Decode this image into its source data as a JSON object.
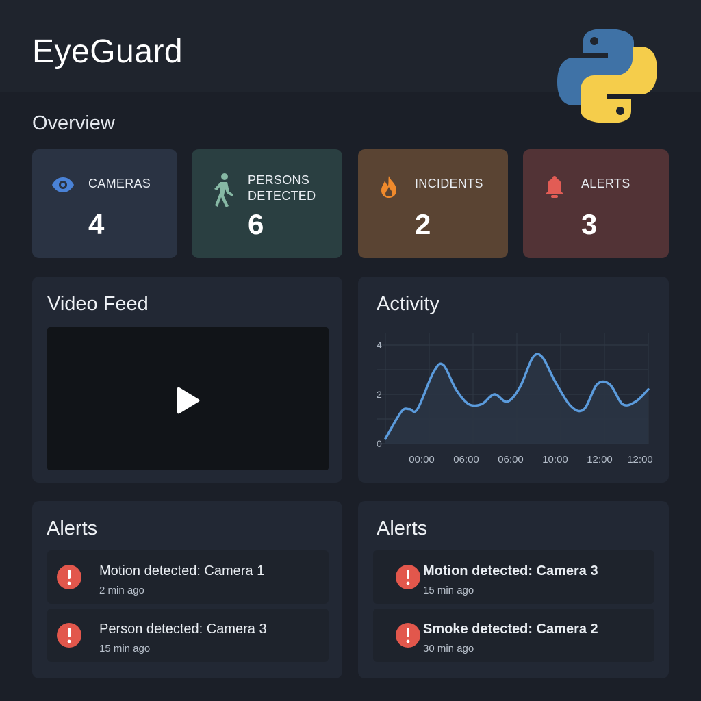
{
  "app": {
    "title": "EyeGuard",
    "logo_icon": "python-logo-icon"
  },
  "overview": {
    "title": "Overview",
    "stats": [
      {
        "label": "CAMERAS",
        "value": "4",
        "icon": "eye-icon",
        "color": "#2a3343",
        "icon_color": "#4a82d6"
      },
      {
        "label": "PERSONS DETECTED",
        "value": "6",
        "icon": "walking-person-icon",
        "color": "#2a3f41",
        "icon_color": "#86b8a4"
      },
      {
        "label": "INCIDENTS",
        "value": "2",
        "icon": "fire-icon",
        "color": "#5a4433",
        "icon_color": "#f08a2c"
      },
      {
        "label": "ALERTS",
        "value": "3",
        "icon": "bell-icon",
        "color": "#523336",
        "icon_color": "#e25c55"
      }
    ]
  },
  "video": {
    "title": "Video Feed",
    "play_icon": "play-icon"
  },
  "activity": {
    "title": "Activity"
  },
  "chart_data": {
    "type": "area",
    "title": "Activity",
    "y_ticks": [
      "0",
      "2",
      "4"
    ],
    "x_ticks": [
      "00:00",
      "06:00",
      "06:00",
      "10:00",
      "12:00",
      "12:00"
    ],
    "ylim": [
      0,
      4.5
    ],
    "grid": true,
    "line_color": "#5b9bdc",
    "series": [
      {
        "values": [
          0.2,
          1.3,
          1.4,
          1.4,
          2.9,
          3.2,
          2.2,
          1.6,
          1.6,
          2.0,
          1.7,
          2.3,
          3.5,
          3.5,
          2.5,
          1.5,
          1.4,
          2.4,
          2.4,
          1.6,
          1.7,
          2.2
        ]
      }
    ],
    "x": [
      0,
      1,
      1.5,
      2,
      3,
      3.6,
      4.4,
      5.2,
      6,
      6.8,
      7.6,
      8.4,
      9.2,
      9.8,
      10.6,
      11.6,
      12.4,
      13.2,
      14,
      14.8,
      15.6,
      16.4
    ]
  },
  "alerts_left": {
    "title": "Alerts",
    "items": [
      {
        "title": "Motion detected: Camera 1",
        "time": "2 min ago",
        "icon": "alert-icon"
      },
      {
        "title": "Person detected: Camera 3",
        "time": "15 min ago",
        "icon": "alert-icon"
      }
    ]
  },
  "alerts_right": {
    "title": "Alerts",
    "items": [
      {
        "title": "Motion detected: Camera 3",
        "time": "15 min ago",
        "icon": "alert-icon"
      },
      {
        "title": "Smoke detected: Camera 2",
        "time": "30 min ago",
        "icon": "alert-icon"
      }
    ]
  },
  "colors": {
    "alert_red": "#e2574c"
  }
}
